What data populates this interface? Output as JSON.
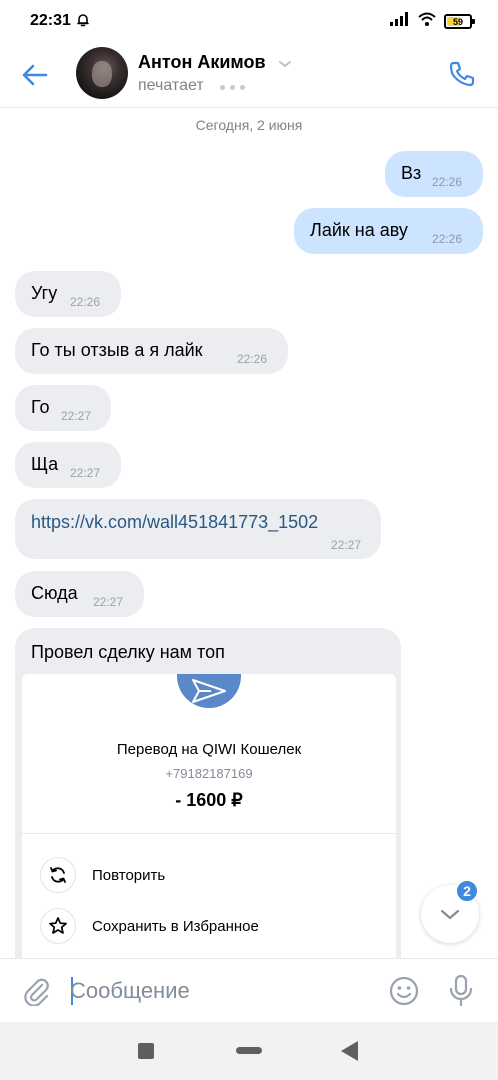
{
  "status_bar": {
    "time": "22:31",
    "battery": "59",
    "battery_level": 0.59
  },
  "header": {
    "contact_name": "Антон Акимов",
    "status": "печатает"
  },
  "date_separator": "Сегодня, 2 июня",
  "messages": [
    {
      "direction": "out",
      "text": "Вз",
      "time": "22:26"
    },
    {
      "direction": "out",
      "text": "Лайк на аву",
      "time": "22:26"
    },
    {
      "direction": "in",
      "text": "Угу",
      "time": "22:26"
    },
    {
      "direction": "in",
      "text": "Го ты отзыв а я лайк",
      "time": "22:26"
    },
    {
      "direction": "in",
      "text": "Го",
      "time": "22:27"
    },
    {
      "direction": "in",
      "text": "Ща",
      "time": "22:27"
    },
    {
      "direction": "in",
      "text": "https://vk.com/wall451841773_1502",
      "time": "22:27"
    },
    {
      "direction": "in",
      "text": "Сюда",
      "time": "22:27"
    },
    {
      "direction": "in",
      "text": "Провел сделку нам топ"
    }
  ],
  "transfer_card": {
    "title": "Перевод на QIWI Кошелек",
    "phone": "+79182187169",
    "amount": "- 1600 ₽",
    "actions": [
      {
        "label": "Повторить",
        "icon": "repeat-icon"
      },
      {
        "label": "Сохранить в Избранное",
        "icon": "star-icon"
      }
    ]
  },
  "scroll_down": {
    "unread_count": "2"
  },
  "composer": {
    "placeholder": "Сообщение"
  },
  "colors": {
    "accent": "#3f8ae0",
    "outgoing_bubble": "#cce4ff",
    "incoming_bubble": "#ebedf0",
    "link": "#2a5885"
  }
}
